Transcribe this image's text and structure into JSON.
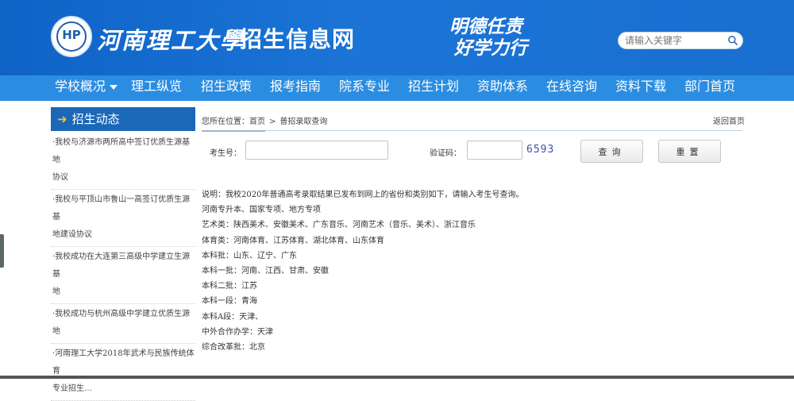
{
  "header": {
    "logo_monogram": "HP",
    "school_name": "河南理工大學",
    "site_name": "招生信息网",
    "motto": [
      "明德任责",
      "好学力行"
    ],
    "search_placeholder": "请输入关键字"
  },
  "nav": {
    "items": [
      {
        "label": "学校概况",
        "has_dropdown": true
      },
      {
        "label": "理工纵览"
      },
      {
        "label": "招生政策"
      },
      {
        "label": "报考指南"
      },
      {
        "label": "院系专业"
      },
      {
        "label": "招生计划"
      },
      {
        "label": "资助体系"
      },
      {
        "label": "在线咨询"
      },
      {
        "label": "资料下载"
      },
      {
        "label": "部门首页"
      }
    ]
  },
  "sidebar": {
    "title": "招生动态",
    "items": [
      {
        "line1": "·我校与济源市两所高中签订优质生源基地",
        "line2": "协议"
      },
      {
        "line1": "·我校与平顶山市鲁山一高签订优质生源基",
        "line2": "地建设协议"
      },
      {
        "line1": "·我校成功在大连第三高级中学建立生源基",
        "line2": "地"
      },
      {
        "line1": "·我校成功与杭州高级中学建立优质生源地",
        "line2": ""
      },
      {
        "line1": "·河南理工大学2018年武术与民族传统体育",
        "line2": "专业招生…"
      }
    ]
  },
  "breadcrumb": {
    "prefix": "您所在位置：",
    "home": "首页",
    "separator": ">",
    "current": "普招录取查询",
    "back_link": "返回首页"
  },
  "query_form": {
    "exam_no_label": "考生号：",
    "exam_no_value": "",
    "captcha_label": "验证码：",
    "captcha_value": "",
    "captcha_code": "6593",
    "query_button": "查询",
    "reset_button": "重置"
  },
  "notes": [
    "说明：我校2020年普通高考录取结果已发布到网上的省份和类别如下，请输入考生号查询。",
    "河南专升本、国家专项、地方专项",
    "艺术类：陕西美术、安徽美术、广东音乐、河南艺术（音乐、美术）、浙江音乐",
    "体育类：河南体育、江苏体育、湖北体育、山东体育",
    "本科批：山东、辽宁、广东",
    "本科一批：河南、江西、甘肃、安徽",
    "本科二批：江苏",
    "本科一段：青海",
    "本科A段：天津、",
    "中外合作办学：天津",
    "综合改革批：北京"
  ],
  "colors": {
    "header_blue": "#1a6fd0",
    "nav_blue": "#2b8de2",
    "sidebar_head": "#1b67b8",
    "captcha_text": "#3e4fa5"
  }
}
